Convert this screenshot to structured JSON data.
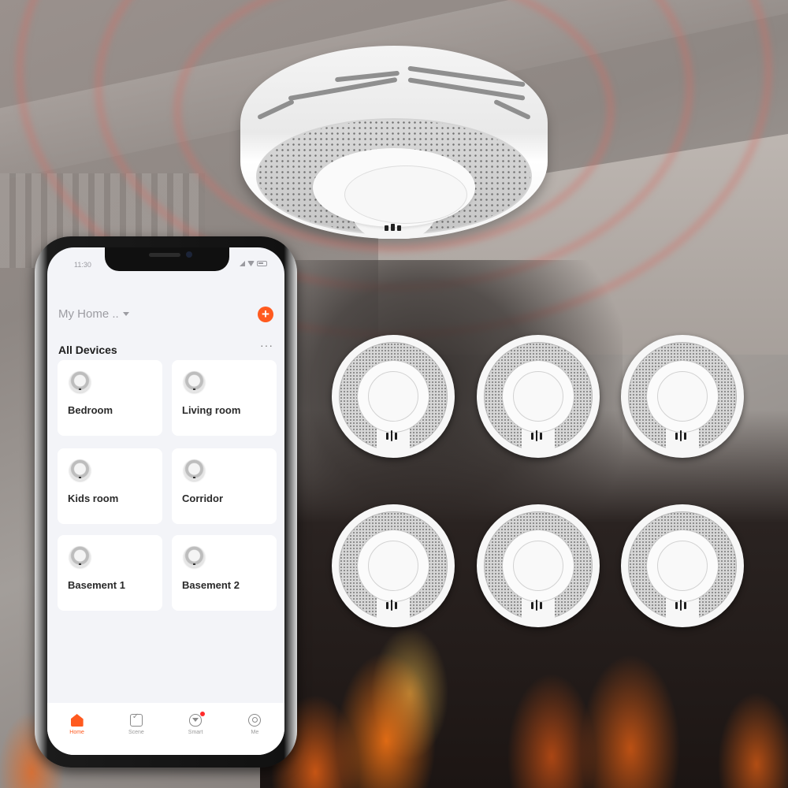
{
  "scene": {
    "description": "Smart smoke detector product scene with ceiling detector, six detectors and a phone app",
    "colors": {
      "accent": "#ff5a1f",
      "alert_ring": "#d66e64",
      "notification_dot": "#ff2b2b"
    }
  },
  "detectors": {
    "ceiling_detector": "large-smoke-detector",
    "grid_count": 6
  },
  "phone": {
    "status_bar": {
      "time": "11:30",
      "icons": [
        "signal-icon",
        "wifi-icon",
        "battery-icon"
      ]
    },
    "header": {
      "home_selector": "My Home ..",
      "add_icon": "plus-icon",
      "add_symbol": "+"
    },
    "section": {
      "title": "All Devices",
      "more_symbol": "···"
    },
    "devices": [
      {
        "label": "Bedroom",
        "icon": "smoke-detector-icon"
      },
      {
        "label": "Living room",
        "icon": "smoke-detector-icon"
      },
      {
        "label": "Kids room",
        "icon": "smoke-detector-icon"
      },
      {
        "label": "Corridor",
        "icon": "smoke-detector-icon"
      },
      {
        "label": "Basement 1",
        "icon": "smoke-detector-icon"
      },
      {
        "label": "Basement 2",
        "icon": "smoke-detector-icon"
      }
    ],
    "tabs": [
      {
        "label": "Home",
        "icon": "home-icon",
        "active": true
      },
      {
        "label": "Scene",
        "icon": "scene-checkbox-icon",
        "active": false
      },
      {
        "label": "Smart",
        "icon": "smart-shield-icon",
        "active": false,
        "badge": true
      },
      {
        "label": "Me",
        "icon": "profile-icon",
        "active": false
      }
    ]
  }
}
